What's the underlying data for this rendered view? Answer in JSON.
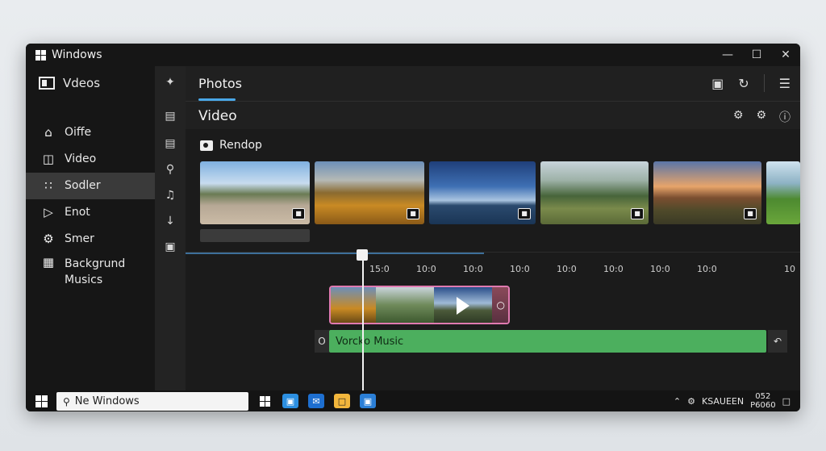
{
  "window": {
    "title": "Windows",
    "controls": [
      "minimize",
      "maximize",
      "close"
    ]
  },
  "sidebar": {
    "header": "Vdeos",
    "items": [
      {
        "label": "Oiffe",
        "icon": "home-icon"
      },
      {
        "label": "Video",
        "icon": "video-icon"
      },
      {
        "label": "Sodler",
        "icon": "grid-icon",
        "active": true
      },
      {
        "label": "Enot",
        "icon": "send-icon"
      },
      {
        "label": "Smer",
        "icon": "gear-icon"
      },
      {
        "label": "Backgrund Musics",
        "icon": "blocks-icon"
      }
    ]
  },
  "rail": [
    "edit-icon",
    "caption-icon",
    "document-icon",
    "search-icon",
    "music-icon",
    "download-icon",
    "bookmark-icon"
  ],
  "header": {
    "tab": "Photos",
    "icons": [
      "export-icon",
      "refresh-icon",
      "menu-icon"
    ]
  },
  "subheader": {
    "title": "Video",
    "icons": [
      "settings-icon",
      "effects-icon",
      "info-icon"
    ]
  },
  "media": {
    "label": "Rendop",
    "thumbnails": [
      {
        "name": "people-on-road"
      },
      {
        "name": "autumn-castle"
      },
      {
        "name": "blue-lake"
      },
      {
        "name": "green-field-sculpture"
      },
      {
        "name": "sunset-tower"
      },
      {
        "name": "green-hills"
      }
    ]
  },
  "timeline": {
    "ticks": [
      "15:0",
      "10:0",
      "10:0",
      "10:0",
      "10:0",
      "10:0",
      "10:0",
      "10:0",
      "10"
    ],
    "audio_lead": "O",
    "audio_label": "Vorcko Music"
  },
  "taskbar": {
    "search_text": "Ne Windows",
    "tray_text": "KSAUEEN",
    "clock_top": "052",
    "clock_bottom": "P6060"
  }
}
